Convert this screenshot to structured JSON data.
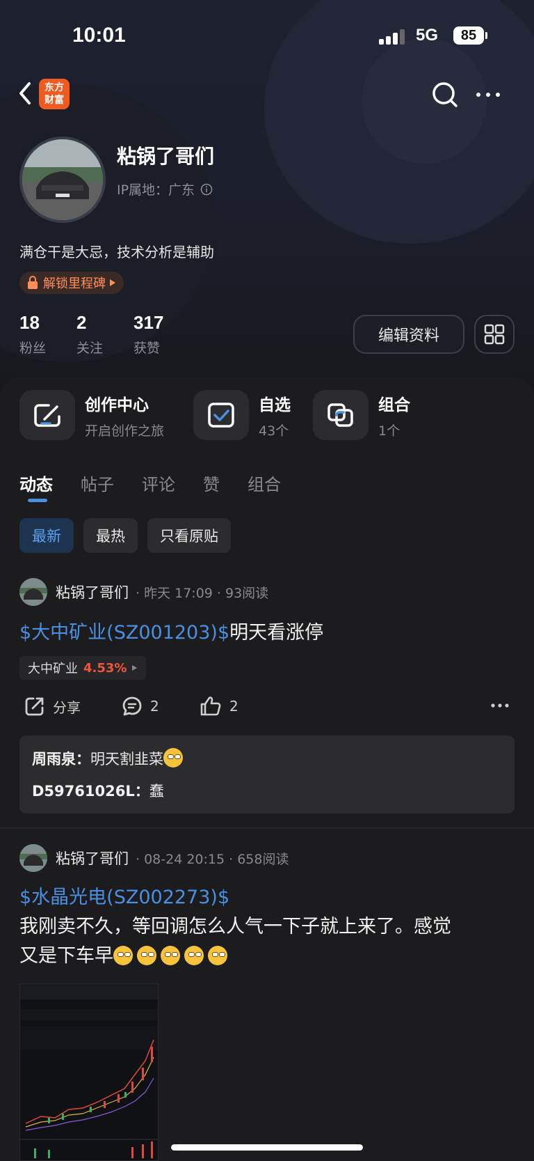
{
  "status_bar": {
    "time": "10:01",
    "network": "5G",
    "battery": "85"
  },
  "app": {
    "logo_line1": "东方",
    "logo_line2": "财富"
  },
  "profile": {
    "name": "粘锅了哥们",
    "ip_location": "IP属地：广东",
    "bio": "满仓干是大忌，技术分析是辅助",
    "badge": "解锁里程碑",
    "stats": [
      {
        "value": "18",
        "label": "粉丝"
      },
      {
        "value": "2",
        "label": "关注"
      },
      {
        "value": "317",
        "label": "获赞"
      }
    ],
    "edit_button": "编辑资料"
  },
  "shortcuts": [
    {
      "title": "创作中心",
      "subtitle": "开启创作之旅",
      "icon": "edit-icon"
    },
    {
      "title": "自选",
      "subtitle": "43个",
      "icon": "checkbox-icon"
    },
    {
      "title": "组合",
      "subtitle": "1个",
      "icon": "portfolio-icon"
    }
  ],
  "tabs": [
    "动态",
    "帖子",
    "评论",
    "赞",
    "组合"
  ],
  "filters": [
    "最新",
    "最热",
    "只看原贴"
  ],
  "posts": [
    {
      "author": "粘锅了哥们",
      "meta": "· 昨天 17:09 · 93阅读",
      "stock_tag": "$大中矿业(SZ001203)$",
      "text": "明天看涨停",
      "stock_chip": {
        "name": "大中矿业",
        "change": "4.53%"
      },
      "share_label": "分享",
      "comment_count": "2",
      "like_count": "2",
      "comments": [
        {
          "user": "周雨泉：",
          "text": "明天割韭菜"
        },
        {
          "user": "D59761026L：",
          "text": "蠢"
        }
      ]
    },
    {
      "author": "粘锅了哥们",
      "meta": "· 08-24 20:15 · 658阅读",
      "stock_tag": "$水晶光电(SZ002273)$",
      "text_line1": "我刚卖不久，等回调怎么人气一下子就上来了。感觉",
      "text_line2": "又是下车早"
    }
  ],
  "colors": {
    "accent": "#4a90e2",
    "up": "#f0563a",
    "brand": "#f05a1e"
  }
}
